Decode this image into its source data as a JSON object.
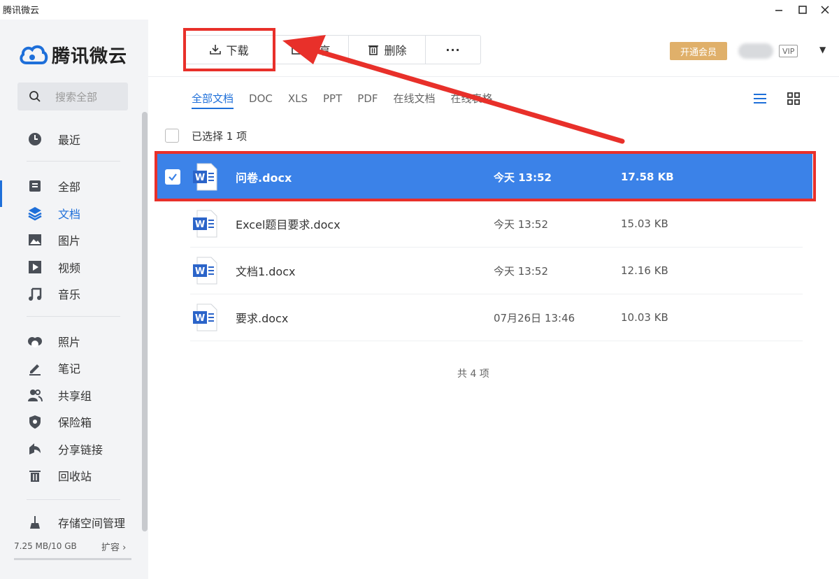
{
  "window": {
    "title": "腾讯微云"
  },
  "sidebar": {
    "app_name": "腾讯微云",
    "search_placeholder": "搜索全部",
    "items": [
      {
        "label": "最近",
        "icon": "clock-icon"
      },
      {
        "label": "全部",
        "icon": "list-icon"
      },
      {
        "label": "文档",
        "icon": "layers-icon",
        "active": true
      },
      {
        "label": "图片",
        "icon": "image-icon"
      },
      {
        "label": "视频",
        "icon": "video-icon"
      },
      {
        "label": "音乐",
        "icon": "music-icon"
      },
      {
        "label": "照片",
        "icon": "photo-icon"
      },
      {
        "label": "笔记",
        "icon": "pen-icon"
      },
      {
        "label": "共享组",
        "icon": "users-icon"
      },
      {
        "label": "保险箱",
        "icon": "shield-icon"
      },
      {
        "label": "分享链接",
        "icon": "share-icon"
      },
      {
        "label": "回收站",
        "icon": "trash-icon"
      },
      {
        "label": "存储空间管理",
        "icon": "broom-icon"
      }
    ],
    "storage_text": "7.25 MB/10 GB",
    "expand_label": "扩容 ›"
  },
  "toolbar": {
    "download_label": "下载",
    "share_label": "分享",
    "delete_label": "删除",
    "more_label": "···",
    "vip_open_label": "开通会员",
    "vip_badge": "VIP"
  },
  "filters": {
    "tabs": [
      "全部文档",
      "DOC",
      "XLS",
      "PPT",
      "PDF",
      "在线文档",
      "在线表格"
    ],
    "active": "全部文档"
  },
  "selection": {
    "text": "已选择 1 项"
  },
  "files": [
    {
      "name": "问卷.docx",
      "date": "今天 13:52",
      "size": "17.58 KB",
      "selected": true
    },
    {
      "name": "Excel题目要求.docx",
      "date": "今天 13:52",
      "size": "15.03 KB",
      "selected": false
    },
    {
      "name": "文档1.docx",
      "date": "今天 13:52",
      "size": "12.16 KB",
      "selected": false
    },
    {
      "name": "要求.docx",
      "date": "07月26日 13:46",
      "size": "10.03 KB",
      "selected": false
    }
  ],
  "footer": {
    "total": "共 4 项"
  },
  "colors": {
    "accent": "#1e6fd9",
    "selected_row": "#3b82e8",
    "annotation": "#e8302a",
    "vip": "#e0b06a"
  }
}
